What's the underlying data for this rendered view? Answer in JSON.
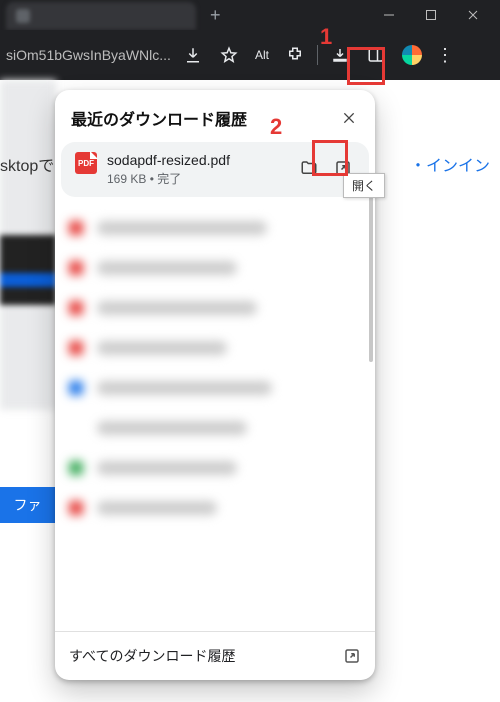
{
  "titlebar": {
    "tab_title": "    ",
    "new_tab": "+"
  },
  "window_controls": {
    "minimize": "−",
    "maximize": "□",
    "close": "✕"
  },
  "toolbar": {
    "url_fragment": "siOm51bGwsInByaWNlc...",
    "alt_label": "Alt",
    "icons": {
      "download": "download-icon",
      "star": "star-icon",
      "extensions": "puzzle-icon",
      "downloads_button": "downloads-tray-icon",
      "side_panel": "side-panel-icon",
      "menu": "kebab-menu-icon"
    }
  },
  "page_bg": {
    "left_text": "sktopで",
    "btn_text": "ファ",
    "right_text": "・インイン"
  },
  "popover": {
    "title": "最近のダウンロード履歴",
    "close": "✕",
    "item": {
      "badge": "PDF",
      "filename": "sodapdf-resized.pdf",
      "size": "169 KB",
      "sep": " • ",
      "status": "完了",
      "folder_btn": "show-in-folder",
      "open_btn": "open-file"
    },
    "tooltip": "開く",
    "footer": "すべてのダウンロード履歴"
  },
  "annotations": {
    "n1": "1",
    "n2": "2"
  }
}
